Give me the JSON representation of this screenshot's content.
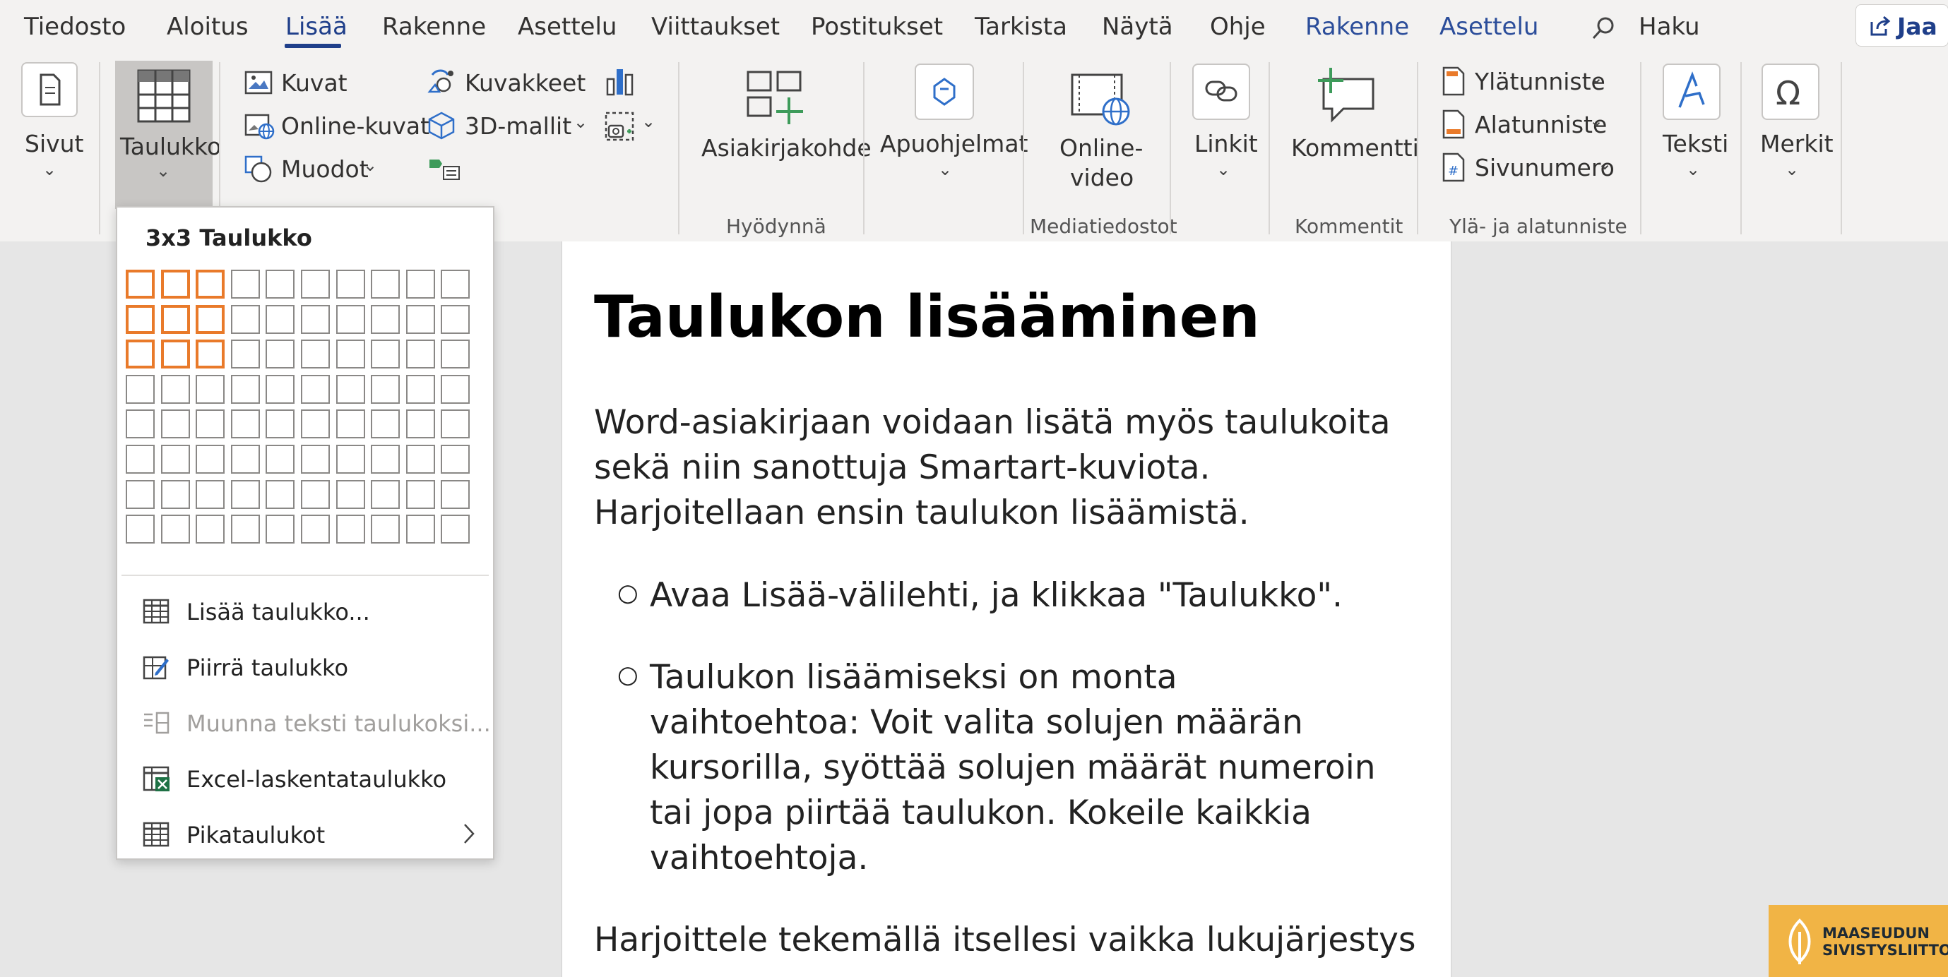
{
  "tabs": [
    "Tiedosto",
    "Aloitus",
    "Lisää",
    "Rakenne",
    "Asettelu",
    "Viittaukset",
    "Postitukset",
    "Tarkista",
    "Näytä",
    "Ohje",
    "Rakenne",
    "Asettelu"
  ],
  "search_label": "Haku",
  "share_label": "Jaa",
  "ribbon": {
    "sivut": "Sivut",
    "taulukko": "Taulukko",
    "kuvat": "Kuvat",
    "online_kuvat": "Online-kuvat",
    "muodot": "Muodot",
    "kuvakkeet": "Kuvakkeet",
    "mallit_3d": "3D-mallit",
    "asiakirjakohde": "Asiakirjakohde",
    "apuohjelmat": "Apuohjelmat",
    "online_video_1": "Online-",
    "online_video_2": "video",
    "linkit": "Linkit",
    "kommentti": "Kommentti",
    "ylatunniste": "Ylätunniste",
    "alatunniste": "Alatunniste",
    "sivunumero": "Sivunumero",
    "teksti": "Teksti",
    "merkit": "Merkit"
  },
  "groups": {
    "hyodynna": "Hyödynnä",
    "mediatiedostot": "Mediatiedostot",
    "kommentit": "Kommentit",
    "yla_ala": "Ylä- ja alatunniste"
  },
  "dropdown": {
    "title": "3x3 Taulukko",
    "grid": {
      "rows": 8,
      "cols": 10,
      "selected_rows": 3,
      "selected_cols": 3
    },
    "items": [
      {
        "label": "Lisää taulukko...",
        "enabled": true
      },
      {
        "label": "Piirrä taulukko",
        "enabled": true
      },
      {
        "label": "Muunna teksti taulukoksi...",
        "enabled": false
      },
      {
        "label": "Excel-laskentataulukko",
        "enabled": true
      },
      {
        "label": "Pikataulukot",
        "enabled": true
      }
    ]
  },
  "document": {
    "title": "Taulukon lisääminen",
    "p1": [
      "Word-asiakirjaan voidaan lisätä myös taulukoita",
      "sekä niin sanottuja Smartart-kuviota.",
      "Harjoitellaan ensin taulukon lisäämistä."
    ],
    "bullet1": "Avaa Lisää-välilehti, ja klikkaa \"Taulukko\".",
    "bullet2": [
      "Taulukon lisäämiseksi on monta",
      "vaihtoehtoa: Voit valita solujen määrän",
      "kursorilla, syöttää solujen määrät numeroin",
      "tai jopa piirtää taulukon. Kokeile kaikkia",
      "vaihtoehtoja."
    ],
    "bullet_symbol": "○",
    "p2": "Harjoittele tekemällä itsellesi vaikka lukujärjestys"
  },
  "logo": {
    "line1": "MAASEUDUN",
    "line2": "SIVISTYSLIITTO"
  },
  "colors": {
    "accent": "#1f3f8a",
    "selection": "#e97a2a",
    "logo_bg": "#f1b445"
  }
}
